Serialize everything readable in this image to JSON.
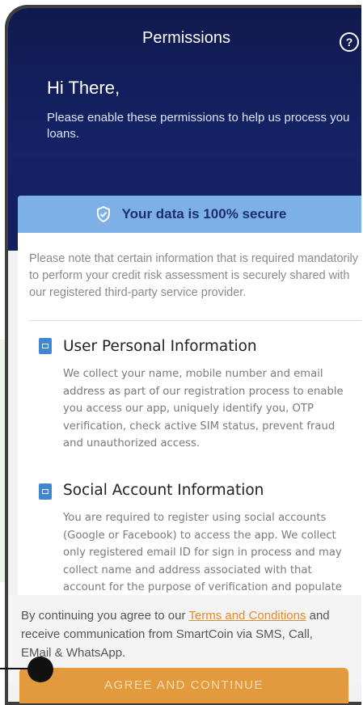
{
  "header": {
    "title": "Permissions",
    "help_icon": "help-circle-icon",
    "greeting": "Hi There,",
    "intro": "Please enable these permissions to help us process you loans."
  },
  "security": {
    "icon": "shield-check-icon",
    "label": "Your data is 100% secure"
  },
  "note": "Please note that certain information that is required mandatorily to perform your credit risk assessment is securely shared with our registered third-party service provider.",
  "sections": [
    {
      "icon": "id-card-icon",
      "title": "User Personal Information",
      "body": "We collect your name, mobile number and email address as part of our registration process to enable you access our app, uniquely identify you, OTP verification, check active SIM status, prevent fraud and unauthorized access."
    },
    {
      "icon": "id-card-icon",
      "title": "Social Account Information",
      "body": "You are required to register using social accounts (Google or Facebook) to access the app. We collect only registered email ID for sign in process and may collect name and address associated with that account for the purpose of verification and populate relevant fields. We do not collect/store"
    }
  ],
  "consent": {
    "prefix": "By continuing you agree to our ",
    "terms_link": "Terms and Conditions",
    "suffix": " and receive communication from SmartCoin via SMS, Call, EMail & WhatsApp."
  },
  "cta": {
    "label": "AGREE AND CONTINUE"
  },
  "colors": {
    "header_bg": "#13205f",
    "secure_bar": "#7db0e6",
    "accent_orange": "#e29a3c",
    "link_orange": "#e28b2a",
    "section_icon": "#3f88cf"
  }
}
